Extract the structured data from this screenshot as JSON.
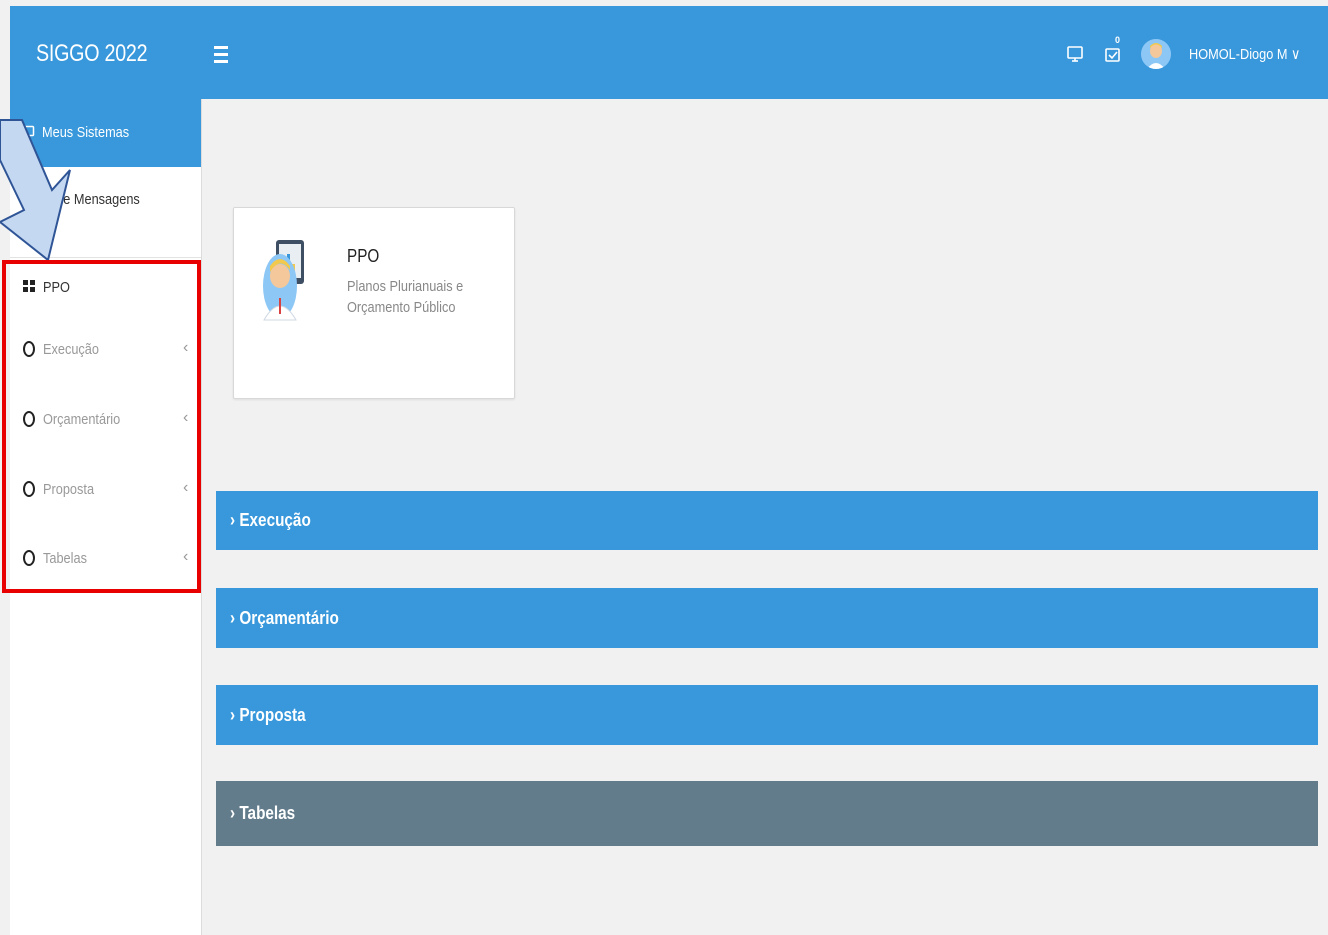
{
  "header": {
    "brand": "SIGGO 2022",
    "notification_count": "0",
    "user_name": "HOMOL-Diogo M ∨",
    "icons": [
      "monitor-icon",
      "message-check-icon",
      "user-avatar-icon",
      "chevron-down-icon"
    ]
  },
  "sidebar": {
    "active_item": "Meus Sistemas",
    "messages_item": "Caixa de Mensagens",
    "messages_visible_text": "ixa de Mensagens",
    "section_title": "PPO",
    "items": [
      {
        "label": "Execução",
        "chevron": "‹"
      },
      {
        "label": "Orçamentário",
        "chevron": "‹"
      },
      {
        "label": "Proposta",
        "chevron": "‹"
      },
      {
        "label": "Tabelas",
        "chevron": "‹"
      }
    ]
  },
  "card": {
    "title": "PPO",
    "subtitle": "Planos Plurianuais e Orçamento Público"
  },
  "accordions": [
    {
      "label": "› Execução",
      "color": "#3898db"
    },
    {
      "label": "› Orçamentário",
      "color": "#3898db"
    },
    {
      "label": "› Proposta",
      "color": "#3898db"
    },
    {
      "label": "› Tabelas",
      "color": "#637c8b"
    }
  ],
  "colors": {
    "primary": "#3898db",
    "dark_accordion": "#637c8b",
    "highlight_border": "#e80000",
    "callout_fill": "#c5d8f1",
    "callout_stroke": "#2f5597"
  }
}
